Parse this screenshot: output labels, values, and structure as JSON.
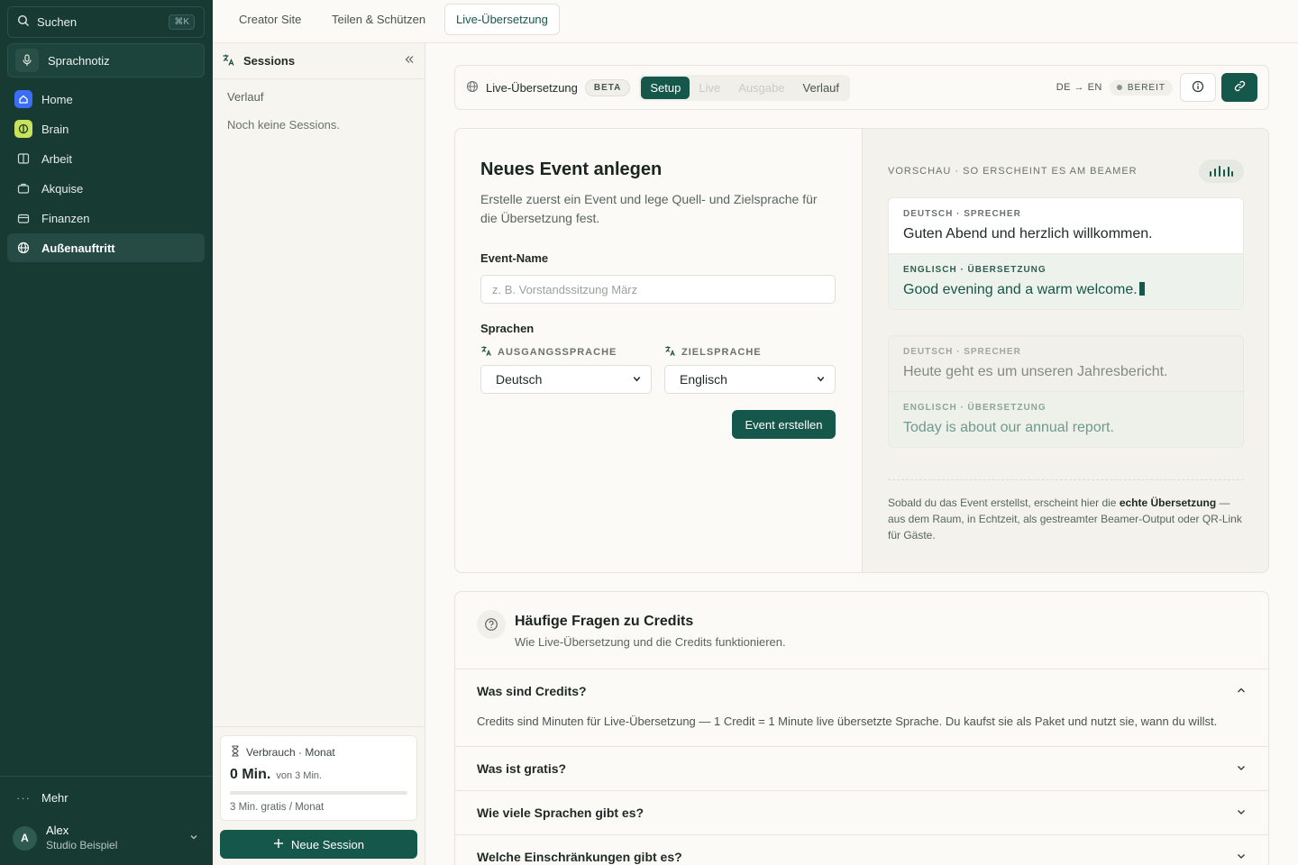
{
  "sidebar": {
    "search_label": "Suchen",
    "search_shortcut": "⌘K",
    "voice_note": "Sprachnotiz",
    "nav": [
      {
        "label": "Home"
      },
      {
        "label": "Brain"
      },
      {
        "label": "Arbeit"
      },
      {
        "label": "Akquise"
      },
      {
        "label": "Finanzen"
      },
      {
        "label": "Außenauftritt",
        "active": true
      }
    ],
    "more": "Mehr",
    "user": {
      "initial": "A",
      "name": "Alex",
      "org": "Studio Beispiel"
    }
  },
  "tabs": [
    {
      "label": "Creator Site"
    },
    {
      "label": "Teilen & Schützen"
    },
    {
      "label": "Live-Übersetzung",
      "active": true
    }
  ],
  "sessions": {
    "title": "Sessions",
    "history_label": "Verlauf",
    "empty": "Noch keine Sessions.",
    "usage": {
      "label": "Verbrauch · Monat",
      "value": "0 Min.",
      "of": "von 3 Min.",
      "progress": 0,
      "footnote": "3 Min. gratis / Monat"
    },
    "new_button": "Neue Session"
  },
  "toolbar": {
    "title": "Live-Übersetzung",
    "badge": "BETA",
    "segments": [
      {
        "label": "Setup",
        "state": "active"
      },
      {
        "label": "Live",
        "state": "disabled"
      },
      {
        "label": "Ausgabe",
        "state": "disabled"
      },
      {
        "label": "Verlauf",
        "state": "normal"
      }
    ],
    "lang_pair": "DE → EN",
    "status": "BEREIT"
  },
  "form": {
    "title": "Neues Event anlegen",
    "subtitle": "Erstelle zuerst ein Event und lege Quell- und Zielsprache für die Übersetzung fest.",
    "event_name_label": "Event-Name",
    "event_name_placeholder": "z. B. Vorstandssitzung März",
    "languages_label": "Sprachen",
    "source_label": "AUSGANGSSPRACHE",
    "target_label": "ZIELSPRACHE",
    "source_value": "Deutsch",
    "target_value": "Englisch",
    "submit": "Event erstellen"
  },
  "preview": {
    "caption": "VORSCHAU · SO ERSCHEINT ES AM BEAMER",
    "blocks": [
      {
        "src_tag": "DEUTSCH · SPRECHER",
        "src_text": "Guten Abend und herzlich willkommen.",
        "tgt_tag": "ENGLISCH · ÜBERSETZUNG",
        "tgt_text": "Good evening and a warm welcome."
      },
      {
        "src_tag": "DEUTSCH · SPRECHER",
        "src_text": "Heute geht es um unseren Jahresbericht.",
        "tgt_tag": "ENGLISCH · ÜBERSETZUNG",
        "tgt_text": "Today is about our annual report."
      }
    ],
    "note_before": "Sobald du das Event erstellst, erscheint hier die ",
    "note_bold": "echte Übersetzung",
    "note_after": " — aus dem Raum, in Echtzeit, als gestreamter Beamer-Output oder QR-Link für Gäste."
  },
  "faq": {
    "title": "Häufige Fragen zu Credits",
    "subtitle": "Wie Live-Übersetzung und die Credits funktionieren.",
    "items": [
      {
        "q": "Was sind Credits?",
        "a": "Credits sind Minuten für Live-Übersetzung — 1 Credit = 1 Minute live übersetzte Sprache. Du kaufst sie als Paket und nutzt sie, wann du willst.",
        "open": true
      },
      {
        "q": "Was ist gratis?"
      },
      {
        "q": "Wie viele Sprachen gibt es?"
      },
      {
        "q": "Welche Einschränkungen gibt es?"
      }
    ]
  },
  "colors": {
    "brand": "#15574a",
    "sidebar": "#173a33",
    "background": "#fbfaf6"
  }
}
